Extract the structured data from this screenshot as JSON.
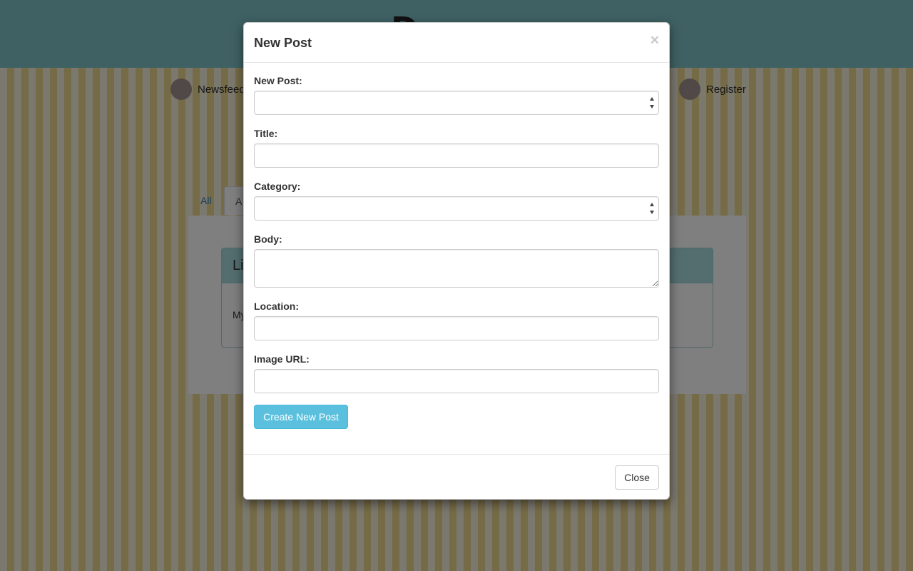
{
  "background": {
    "brand_letter": "D",
    "nav": {
      "newsfeed": "Newsfeed",
      "register": "Register"
    },
    "tabs": {
      "all": "All",
      "active_partial": "A"
    },
    "card": {
      "title_partial": "Li",
      "body_partial": "My"
    }
  },
  "modal": {
    "title": "New Post",
    "close_symbol": "×",
    "fields": {
      "post_type_label": "New Post:",
      "title_label": "Title:",
      "category_label": "Category:",
      "body_label": "Body:",
      "location_label": "Location:",
      "image_url_label": "Image URL:"
    },
    "values": {
      "post_type": "",
      "title": "",
      "category": "",
      "body": "",
      "location": "",
      "image_url": ""
    },
    "submit_label": "Create New Post",
    "close_label": "Close"
  },
  "colors": {
    "header_bar": "#7fc3c9",
    "submit_button": "#5bc0de",
    "card_header": "#a9dde1",
    "stripe_yellow": "#ecd68e"
  },
  "icons": {
    "dismiss": "close-icon",
    "select_arrows": "select-arrows-icon"
  }
}
